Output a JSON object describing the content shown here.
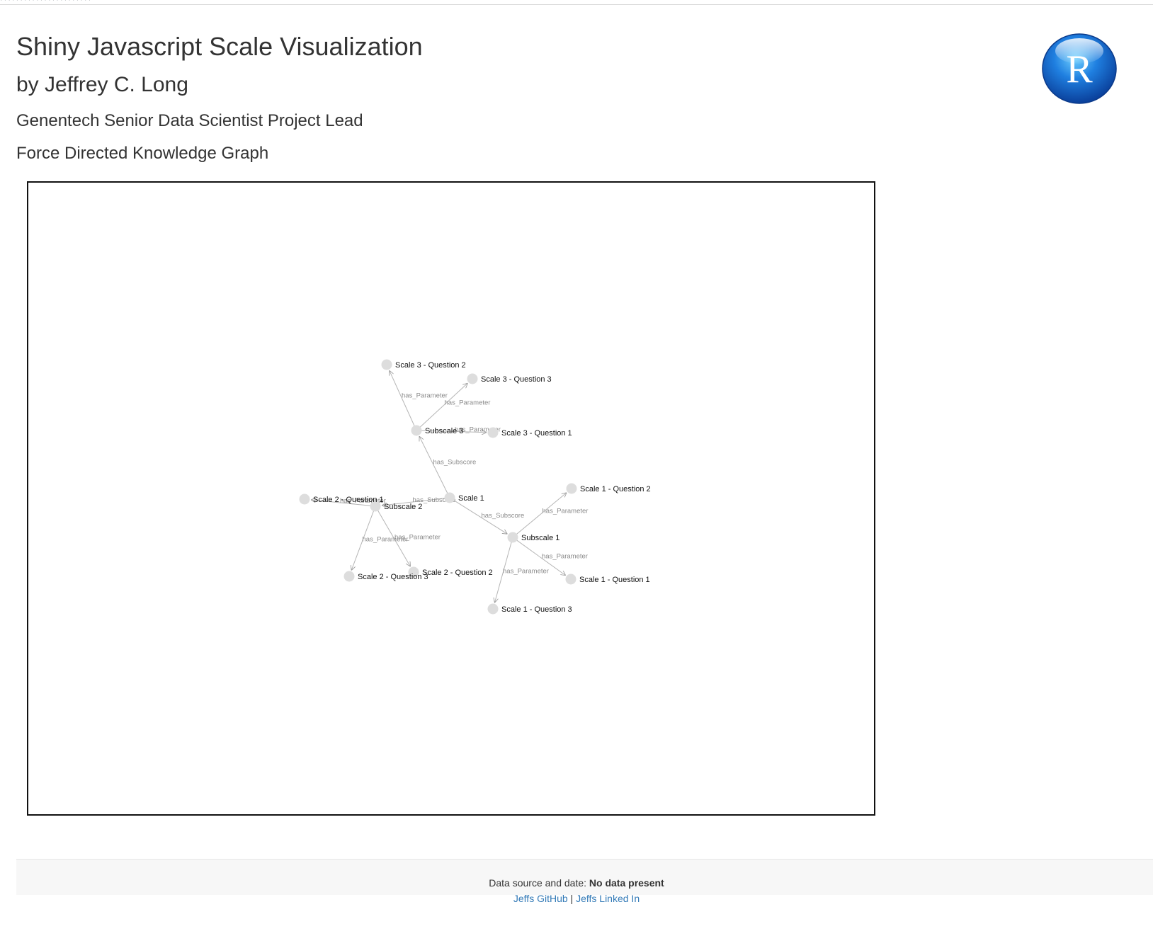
{
  "header": {
    "title": "Shiny Javascript Scale Visualization",
    "author": "by Jeffrey C. Long",
    "organization": "Genentech Senior Data Scientist Project Lead",
    "graph_heading": "Force Directed Knowledge Graph",
    "logo_letter": "R"
  },
  "graph": {
    "nodes": [
      {
        "id": "scale1",
        "label": "Scale 1"
      },
      {
        "id": "subscale1",
        "label": "Subscale 1"
      },
      {
        "id": "subscale2",
        "label": "Subscale 2"
      },
      {
        "id": "subscale3",
        "label": "Subscale 3"
      },
      {
        "id": "s1q1",
        "label": "Scale 1 - Question 1"
      },
      {
        "id": "s1q2",
        "label": "Scale 1 - Question 2"
      },
      {
        "id": "s1q3",
        "label": "Scale 1 - Question 3"
      },
      {
        "id": "s2q1",
        "label": "Scale 2 - Question 1"
      },
      {
        "id": "s2q2",
        "label": "Scale 2 - Question 2"
      },
      {
        "id": "s2q3",
        "label": "Scale 2 - Question 3"
      },
      {
        "id": "s3q1",
        "label": "Scale 3 - Question 1"
      },
      {
        "id": "s3q2",
        "label": "Scale 3 - Question 2"
      },
      {
        "id": "s3q3",
        "label": "Scale 3 - Question 3"
      }
    ],
    "edges": [
      {
        "source": "scale1",
        "target": "subscale1",
        "label": "has_Subscore"
      },
      {
        "source": "scale1",
        "target": "subscale2",
        "label": "has_Subscore"
      },
      {
        "source": "scale1",
        "target": "subscale3",
        "label": "has_Subscore"
      },
      {
        "source": "subscale1",
        "target": "s1q1",
        "label": "has_Parameter"
      },
      {
        "source": "subscale1",
        "target": "s1q2",
        "label": "has_Parameter"
      },
      {
        "source": "subscale1",
        "target": "s1q3",
        "label": "has_Parameter"
      },
      {
        "source": "subscale2",
        "target": "s2q1",
        "label": "has_Parameter"
      },
      {
        "source": "subscale2",
        "target": "s2q2",
        "label": "has_Parameter"
      },
      {
        "source": "subscale2",
        "target": "s2q3",
        "label": "has_Parameter"
      },
      {
        "source": "subscale3",
        "target": "s3q1",
        "label": "has_Parameter"
      },
      {
        "source": "subscale3",
        "target": "s3q2",
        "label": "has_Parameter"
      },
      {
        "source": "subscale3",
        "target": "s3q3",
        "label": "has_Parameter"
      }
    ]
  },
  "footer": {
    "source_prefix": "Data source and date:",
    "source_value": "No data present",
    "link_github": "Jeffs GitHub",
    "separator": "|",
    "link_linkedin": "Jeffs Linked In"
  }
}
